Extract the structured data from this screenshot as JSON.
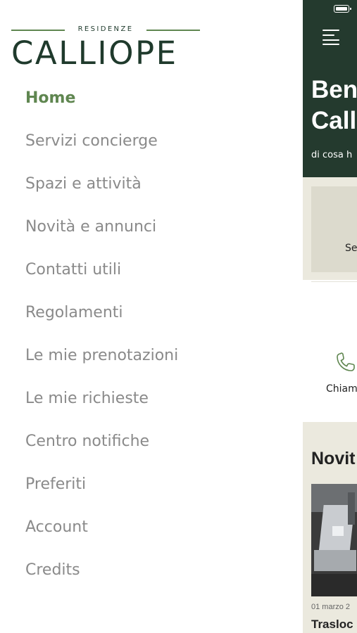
{
  "logo": {
    "subtitle": "RESIDENZE",
    "name": "CALLIOPE"
  },
  "menu": {
    "items": [
      {
        "label": "Home",
        "active": true
      },
      {
        "label": "Servizi concierge",
        "active": false
      },
      {
        "label": "Spazi e attività",
        "active": false
      },
      {
        "label": "Novità e annunci",
        "active": false
      },
      {
        "label": "Contatti utili",
        "active": false
      },
      {
        "label": "Regolamenti",
        "active": false
      },
      {
        "label": "Le mie prenotazioni",
        "active": false
      },
      {
        "label": "Le mie richieste",
        "active": false
      },
      {
        "label": "Centro notifiche",
        "active": false
      },
      {
        "label": "Preferiti",
        "active": false
      },
      {
        "label": "Account",
        "active": false
      },
      {
        "label": "Credits",
        "active": false
      }
    ]
  },
  "main": {
    "title_line1": "Ben",
    "title_line2": "Call",
    "subtitle": "di cosa h",
    "service_card_label": "Se",
    "call_label": "Chiam",
    "news_heading": "Novit",
    "news_date": "01 marzo 2",
    "news_title": "Trasloc"
  },
  "colors": {
    "accent_green": "#5f8650",
    "header_dark_green": "#243a2e",
    "menu_text_gray": "#8a8a8a",
    "background_beige": "#ebe9de"
  },
  "icons": {
    "menu": "hamburger-icon",
    "status": "battery-icon",
    "call": "phone-icon"
  }
}
